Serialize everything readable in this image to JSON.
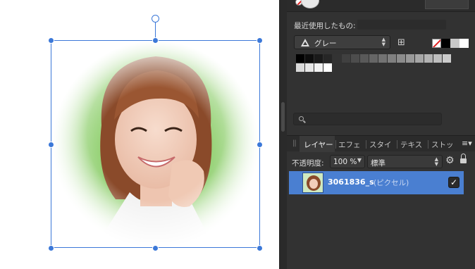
{
  "canvas": {
    "image_alt": "smiling woman portrait with vignette"
  },
  "panel": {
    "recent_label": "最近使用したもの:",
    "palette": {
      "select_label": "グレー",
      "quick_swatches": [
        "none",
        "#000000",
        "#c8c8c8",
        "#ffffff"
      ],
      "row1": [
        "#000000",
        "#0d0d0d",
        "#1a1a1a",
        "#262626",
        "#333333",
        "#404040",
        "#4d4d4d",
        "#595959",
        "#666666",
        "#737373",
        "#808080",
        "#8c8c8c",
        "#999999",
        "#a6a6a6",
        "#b3b3b3",
        "#bfbfbf",
        "#cccccc"
      ],
      "row2": [
        "#d9d9d9",
        "#e6e6e6",
        "#f2f2f2",
        "#ffffff"
      ]
    },
    "search": {
      "placeholder": ""
    },
    "tabs": [
      {
        "label": "レイヤー",
        "active": true
      },
      {
        "label": "エフェ",
        "active": false
      },
      {
        "label": "スタイ",
        "active": false
      },
      {
        "label": "テキス",
        "active": false
      },
      {
        "label": "ストッ",
        "active": false
      }
    ],
    "opacity_label": "不透明度:",
    "opacity_value": "100 %",
    "blend_mode": "標準",
    "layers": [
      {
        "name": "3061836_s",
        "type": "(ピクセル)",
        "visible": true,
        "selected": true
      }
    ],
    "colors": {
      "accent": "#4a7fd1",
      "selection": "#3b78d8",
      "panel_bg": "#323232"
    }
  }
}
